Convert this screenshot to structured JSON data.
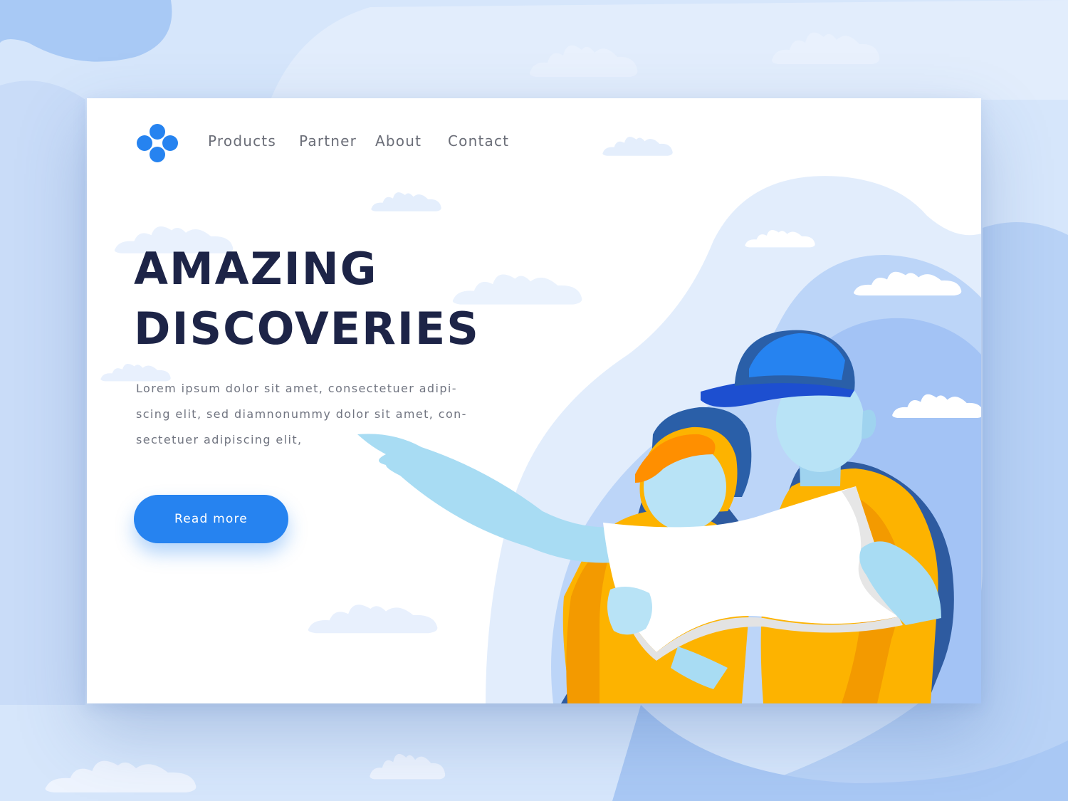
{
  "brand": {
    "logo_icon": "four-dot-logo-icon",
    "accent_color": "#2683f0"
  },
  "nav": {
    "items": [
      {
        "label": "Products"
      },
      {
        "label": "Partner"
      },
      {
        "label": "About"
      },
      {
        "label": "Contact"
      }
    ]
  },
  "hero": {
    "headline_line1": "AMAZING",
    "headline_line2": "DISCOVERIES",
    "description_lines": [
      "Lorem ipsum dolor sit amet, consectetuer adipi-",
      "scing elit, sed diamnonummy dolor sit amet, con-",
      "sectetuer adipiscing elit,"
    ],
    "cta_label": "Read more"
  },
  "colors": {
    "headline": "#1d2447",
    "body_text": "#707480",
    "background": "#d6e6fb"
  }
}
